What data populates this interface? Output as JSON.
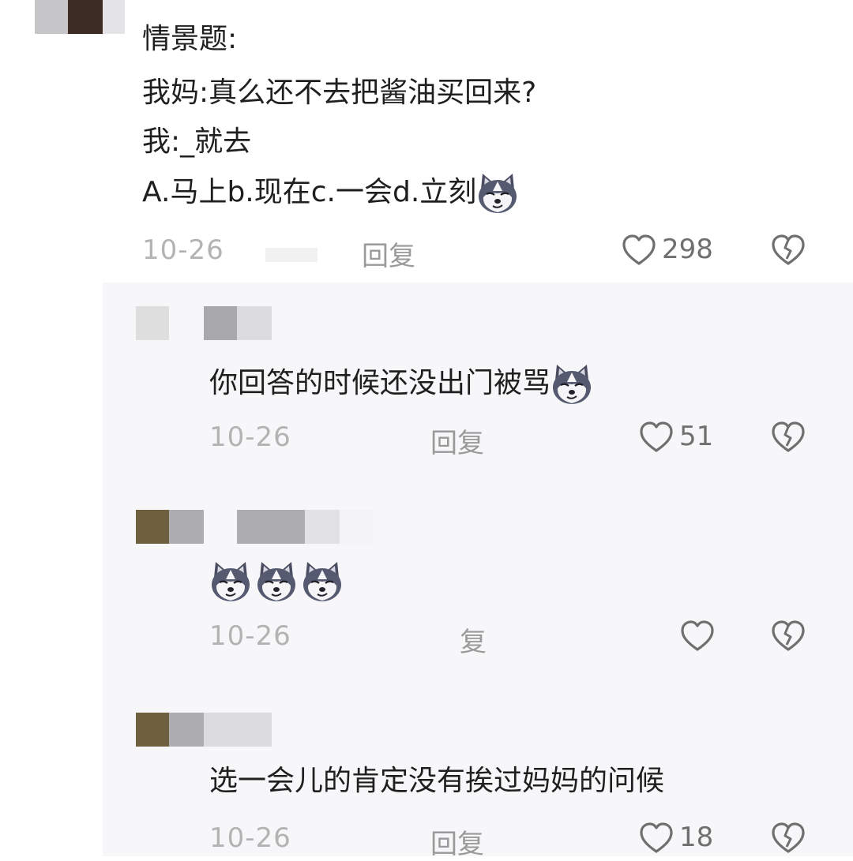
{
  "comments": [
    {
      "lines": [
        "情景题:",
        "我妈:真么还不去把酱油买回来?",
        "我:_就去",
        "A.马上b.现在c.一会d.立刻"
      ],
      "has_emoji": true,
      "date": "10-26",
      "reply": "回复",
      "likes": "298"
    },
    {
      "text": "你回答的时候还没出门被骂",
      "has_emoji": true,
      "date": "10-26",
      "reply": "回复",
      "likes": "51"
    },
    {
      "emoji_count": 3,
      "date": "10-26",
      "reply": "复",
      "likes": ""
    },
    {
      "text": "选一会儿的肯定没有挨过妈妈的问候",
      "date": "10-26",
      "reply": "回复",
      "likes": "18"
    }
  ],
  "icons": {
    "like": "heart-outline-icon",
    "dislike": "broken-heart-icon",
    "emoji": "husky-dog-emoji"
  },
  "colors": {
    "text": "#1f1f1f",
    "meta": "#b3b3b3",
    "icon": "#6f6f6f",
    "reply_bg": "#f7f7f9"
  }
}
